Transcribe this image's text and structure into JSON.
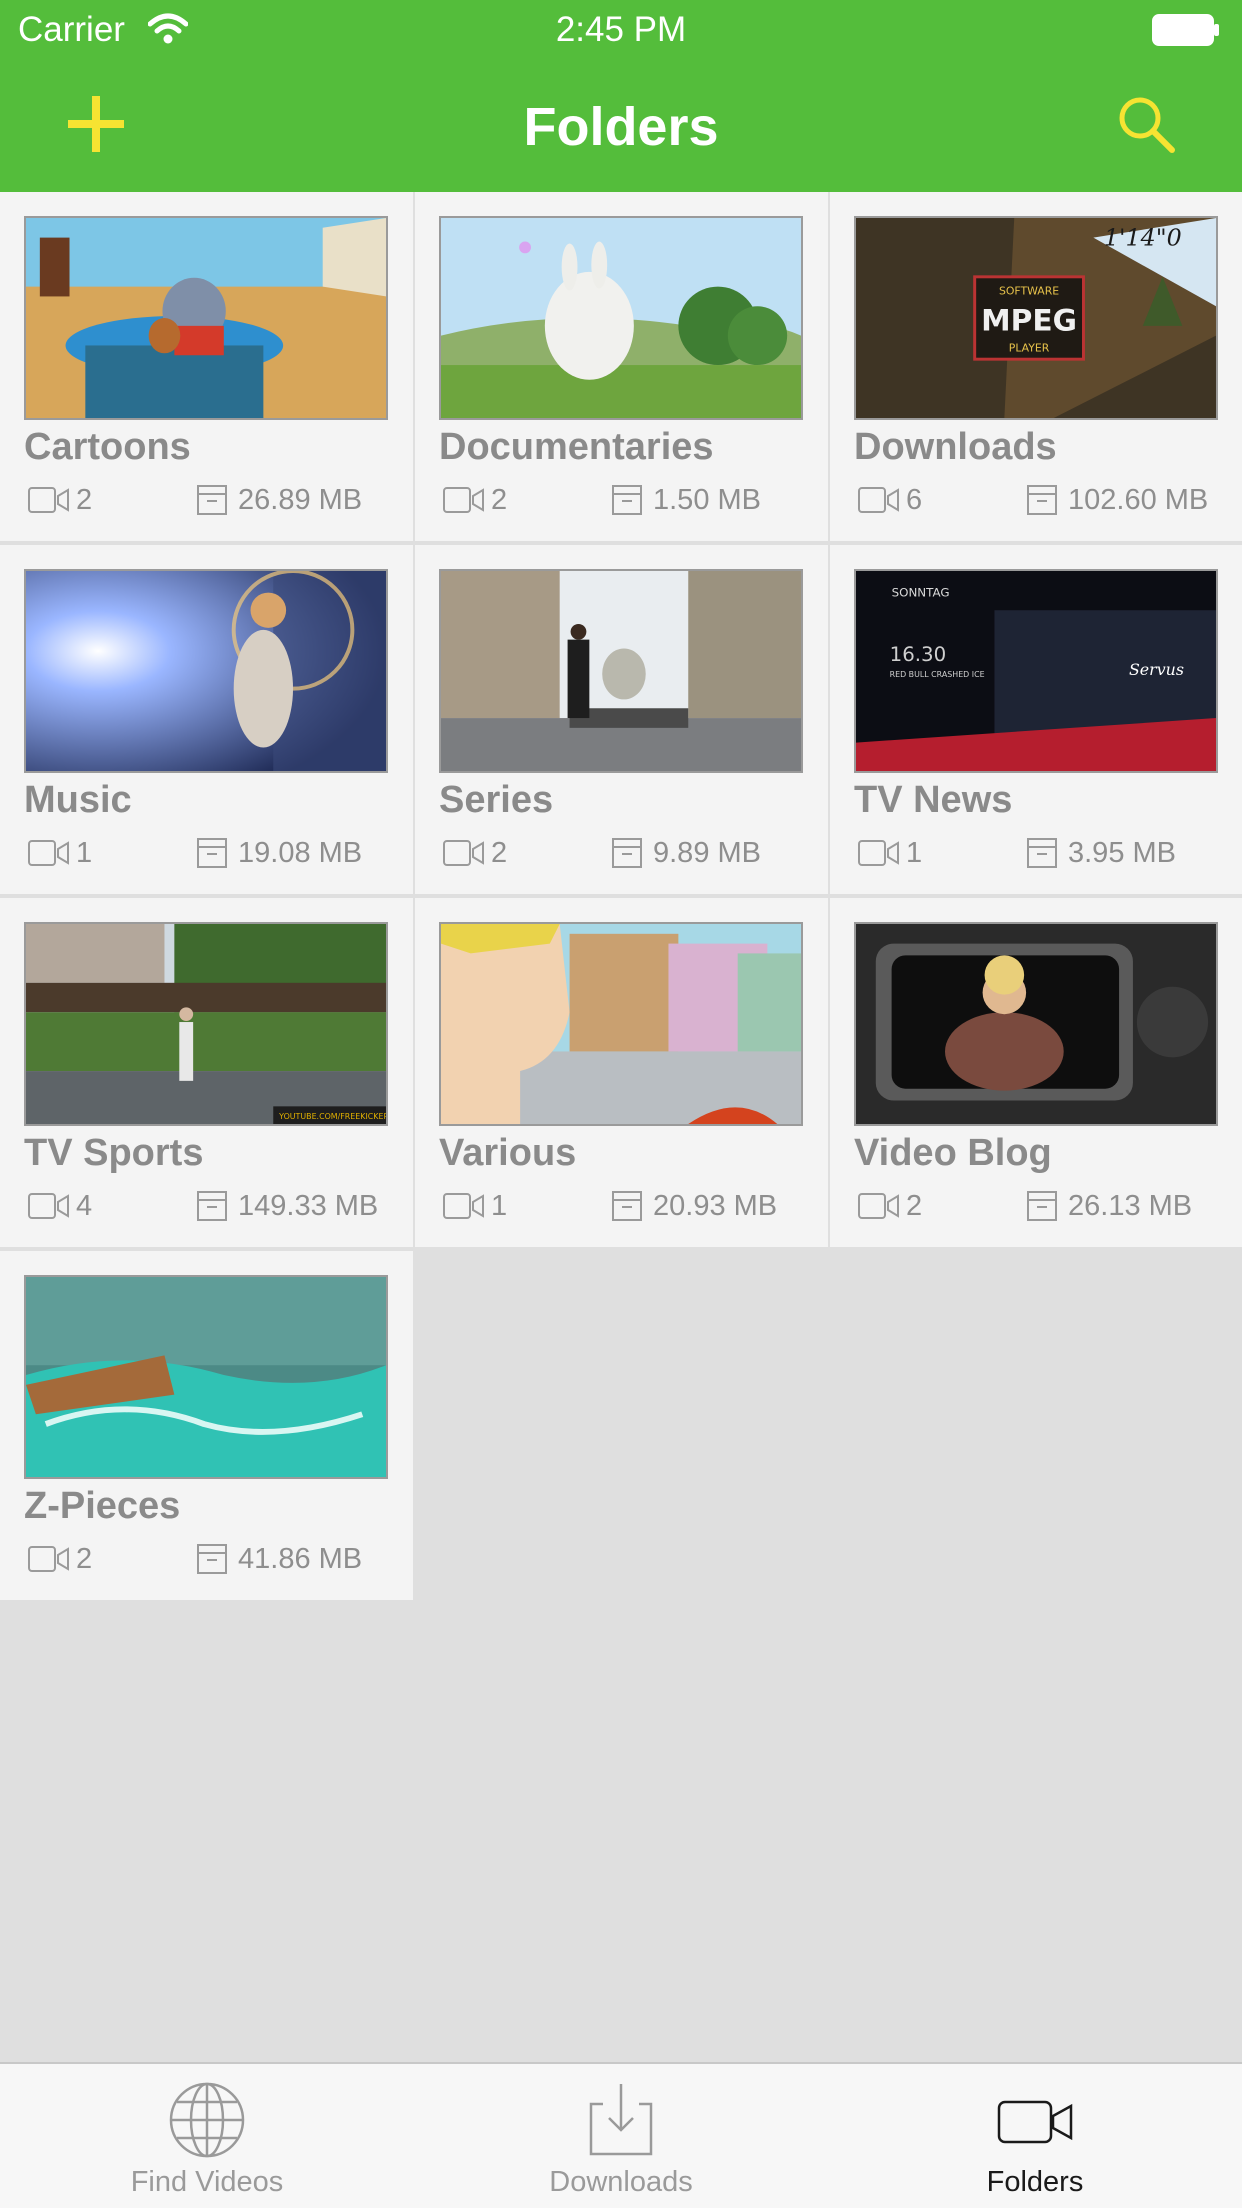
{
  "status_bar": {
    "carrier": "Carrier",
    "time": "2:45 PM"
  },
  "nav": {
    "title": "Folders",
    "add_icon": "plus-icon",
    "search_icon": "search-icon"
  },
  "colors": {
    "accent": "#54bd3b",
    "icon_yellow": "#f6e332",
    "card_bg": "#f4f4f4",
    "page_bg": "#dfdfdf"
  },
  "folders": [
    {
      "name": "Cartoons",
      "count": "2",
      "size": "26.89 MB"
    },
    {
      "name": "Documentaries",
      "count": "2",
      "size": "1.50 MB"
    },
    {
      "name": "Downloads",
      "count": "6",
      "size": "102.60 MB"
    },
    {
      "name": "Music",
      "count": "1",
      "size": "19.08 MB"
    },
    {
      "name": "Series",
      "count": "2",
      "size": "9.89 MB"
    },
    {
      "name": "TV News",
      "count": "1",
      "size": "3.95 MB"
    },
    {
      "name": "TV Sports",
      "count": "4",
      "size": "149.33 MB"
    },
    {
      "name": "Various",
      "count": "1",
      "size": "20.93 MB"
    },
    {
      "name": "Video Blog",
      "count": "2",
      "size": "26.13 MB"
    },
    {
      "name": "Z-Pieces",
      "count": "2",
      "size": "41.86 MB"
    }
  ],
  "thumbnail_text": {
    "downloads_logo_top": "SOFTWARE",
    "downloads_logo_main": "MPEG",
    "downloads_logo_bottom": "PLAYER",
    "downloads_counter": "1'14\"0",
    "news_day": "SONNTAG",
    "news_time": "16.30",
    "news_caption": "RED BULL CRASHED ICE",
    "news_logo": "Servus",
    "sports_watermark": "YOUTUBE.COM/FREEKICKERZ"
  },
  "tabs": [
    {
      "label": "Find Videos",
      "icon": "globe-icon",
      "active": false
    },
    {
      "label": "Downloads",
      "icon": "download-tray-icon",
      "active": false
    },
    {
      "label": "Folders",
      "icon": "video-camera-icon",
      "active": true
    }
  ]
}
